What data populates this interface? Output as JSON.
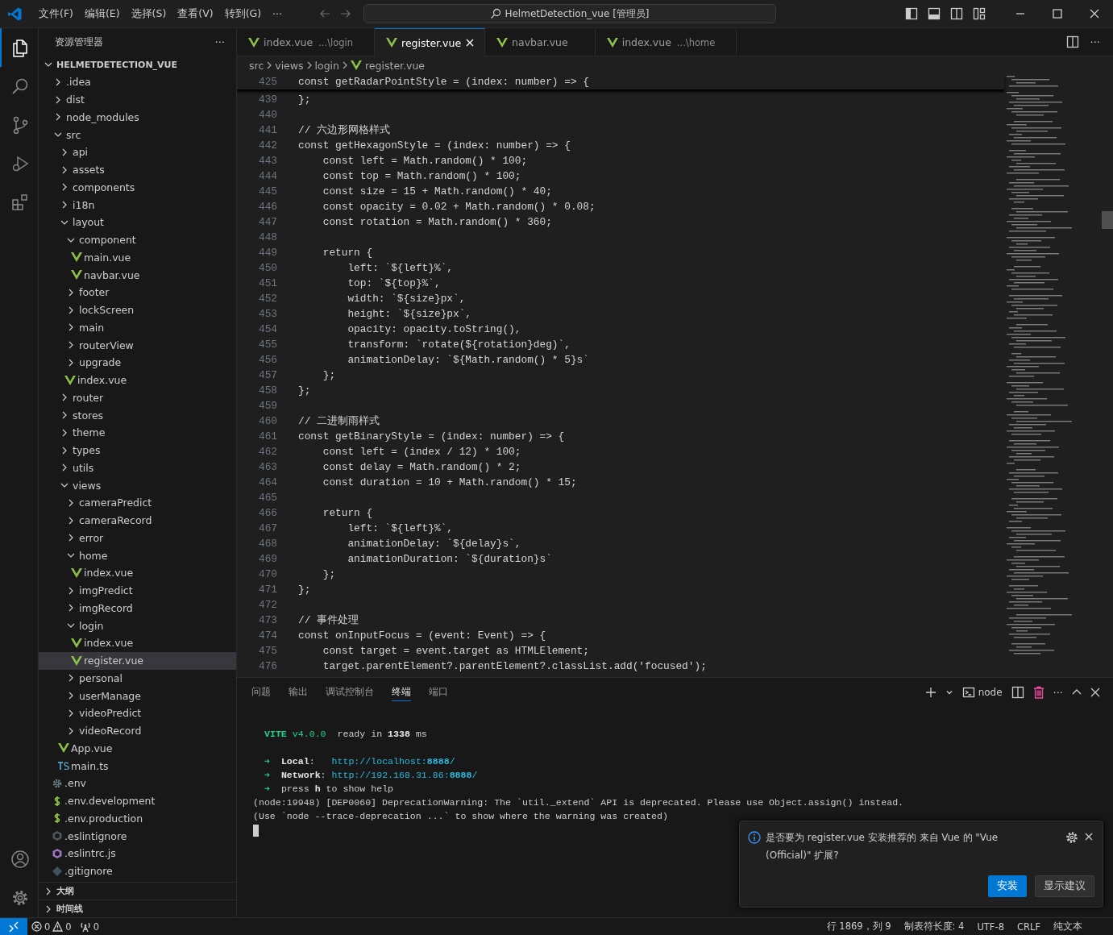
{
  "title_bar": {
    "menus": [
      "文件(F)",
      "编辑(E)",
      "选择(S)",
      "查看(V)",
      "转到(G)"
    ],
    "more": "···",
    "command_center": "HelmetDetection_vue [管理员]"
  },
  "activity_bar": {
    "items": [
      {
        "kind": "explorer",
        "selected": true
      },
      {
        "kind": "search",
        "selected": false
      },
      {
        "kind": "scm",
        "selected": false
      },
      {
        "kind": "debug",
        "selected": false
      },
      {
        "kind": "extensions",
        "selected": false
      }
    ],
    "bottom": [
      {
        "kind": "account"
      },
      {
        "kind": "settings"
      }
    ]
  },
  "sidebar": {
    "title": "资源管理器",
    "more": "···",
    "root": {
      "label": "HELMETDETECTION_VUE",
      "expanded": true
    },
    "tree": [
      {
        "label": ".idea",
        "kind": "folder",
        "expanded": false,
        "selected": false
      },
      {
        "label": "dist",
        "kind": "folder",
        "expanded": false,
        "selected": false
      },
      {
        "label": "node_modules",
        "kind": "folder",
        "expanded": false,
        "selected": false
      },
      {
        "label": "src",
        "kind": "folder",
        "expanded": true,
        "selected": false,
        "children": [
          {
            "label": "api",
            "kind": "folder",
            "expanded": false,
            "selected": false
          },
          {
            "label": "assets",
            "kind": "folder",
            "expanded": false,
            "selected": false
          },
          {
            "label": "components",
            "kind": "folder",
            "expanded": false,
            "selected": false
          },
          {
            "label": "i18n",
            "kind": "folder",
            "expanded": false,
            "selected": false
          },
          {
            "label": "layout",
            "kind": "folder",
            "expanded": true,
            "selected": false,
            "children": [
              {
                "label": "component",
                "kind": "folder",
                "expanded": true,
                "selected": false,
                "children": [
                  {
                    "label": "main.vue",
                    "kind": "vue",
                    "selected": false
                  },
                  {
                    "label": "navbar.vue",
                    "kind": "vue",
                    "selected": false
                  }
                ]
              },
              {
                "label": "footer",
                "kind": "folder",
                "expanded": false,
                "selected": false
              },
              {
                "label": "lockScreen",
                "kind": "folder",
                "expanded": false,
                "selected": false
              },
              {
                "label": "main",
                "kind": "folder",
                "expanded": false,
                "selected": false
              },
              {
                "label": "routerView",
                "kind": "folder",
                "expanded": false,
                "selected": false
              },
              {
                "label": "upgrade",
                "kind": "folder",
                "expanded": false,
                "selected": false
              },
              {
                "label": "index.vue",
                "kind": "vue",
                "selected": false
              }
            ]
          },
          {
            "label": "router",
            "kind": "folder",
            "expanded": false,
            "selected": false
          },
          {
            "label": "stores",
            "kind": "folder",
            "expanded": false,
            "selected": false
          },
          {
            "label": "theme",
            "kind": "folder",
            "expanded": false,
            "selected": false
          },
          {
            "label": "types",
            "kind": "folder",
            "expanded": false,
            "selected": false
          },
          {
            "label": "utils",
            "kind": "folder",
            "expanded": false,
            "selected": false
          },
          {
            "label": "views",
            "kind": "folder",
            "expanded": true,
            "selected": false,
            "children": [
              {
                "label": "cameraPredict",
                "kind": "folder",
                "expanded": false,
                "selected": false
              },
              {
                "label": "cameraRecord",
                "kind": "folder",
                "expanded": false,
                "selected": false
              },
              {
                "label": "error",
                "kind": "folder",
                "expanded": false,
                "selected": false
              },
              {
                "label": "home",
                "kind": "folder",
                "expanded": true,
                "selected": false,
                "children": [
                  {
                    "label": "index.vue",
                    "kind": "vue",
                    "selected": false
                  }
                ]
              },
              {
                "label": "imgPredict",
                "kind": "folder",
                "expanded": false,
                "selected": false
              },
              {
                "label": "imgRecord",
                "kind": "folder",
                "expanded": false,
                "selected": false
              },
              {
                "label": "login",
                "kind": "folder",
                "expanded": true,
                "selected": false,
                "children": [
                  {
                    "label": "index.vue",
                    "kind": "vue",
                    "selected": false
                  },
                  {
                    "label": "register.vue",
                    "kind": "vue",
                    "selected": true
                  }
                ]
              },
              {
                "label": "personal",
                "kind": "folder",
                "expanded": false,
                "selected": false
              },
              {
                "label": "userManage",
                "kind": "folder",
                "expanded": false,
                "selected": false
              },
              {
                "label": "videoPredict",
                "kind": "folder",
                "expanded": false,
                "selected": false
              },
              {
                "label": "videoRecord",
                "kind": "folder",
                "expanded": false,
                "selected": false
              }
            ]
          },
          {
            "label": "App.vue",
            "kind": "vue",
            "selected": false
          },
          {
            "label": "main.ts",
            "kind": "ts",
            "selected": false
          }
        ]
      },
      {
        "label": ".env",
        "kind": "gear",
        "selected": false
      },
      {
        "label": ".env.development",
        "kind": "dollar",
        "selected": false
      },
      {
        "label": ".env.production",
        "kind": "dollar",
        "selected": false
      },
      {
        "label": ".eslintignore",
        "kind": "ring",
        "selected": false
      },
      {
        "label": ".eslintrc.js",
        "kind": "eslint",
        "selected": false
      },
      {
        "label": ".gitignore",
        "kind": "git",
        "selected": false
      }
    ],
    "sections": [
      {
        "label": "大纲",
        "expanded": false
      },
      {
        "label": "时间线",
        "expanded": false
      }
    ]
  },
  "editor": {
    "tabs": [
      {
        "label": "index.vue",
        "description": "...\\login",
        "selected": false
      },
      {
        "label": "register.vue",
        "selected": true
      },
      {
        "label": "navbar.vue",
        "selected": false
      },
      {
        "label": "index.vue",
        "description": "...\\home",
        "selected": false
      }
    ],
    "breadcrumb": [
      "src",
      "views",
      "login",
      "register.vue"
    ],
    "sticky_line": {
      "number": "425",
      "text": "const getRadarPointStyle = (index: number) => {"
    },
    "lines": [
      {
        "number": "439",
        "text": "};"
      },
      {
        "number": "440"
      },
      {
        "number": "441",
        "text": "// 六边形网格样式"
      },
      {
        "number": "442",
        "text": "const getHexagonStyle = (index: number) => {"
      },
      {
        "number": "443",
        "text": "    const left = Math.random() * 100;"
      },
      {
        "number": "444",
        "text": "    const top = Math.random() * 100;"
      },
      {
        "number": "445",
        "text": "    const size = 15 + Math.random() * 40;"
      },
      {
        "number": "446",
        "text": "    const opacity = 0.02 + Math.random() * 0.08;"
      },
      {
        "number": "447",
        "text": "    const rotation = Math.random() * 360;"
      },
      {
        "number": "448"
      },
      {
        "number": "449",
        "text": "    return {"
      },
      {
        "number": "450",
        "text": "        left: `${left}%`,"
      },
      {
        "number": "451",
        "text": "        top: `${top}%`,"
      },
      {
        "number": "452",
        "text": "        width: `${size}px`,"
      },
      {
        "number": "453",
        "text": "        height: `${size}px`,"
      },
      {
        "number": "454",
        "text": "        opacity: opacity.toString(),"
      },
      {
        "number": "455",
        "text": "        transform: `rotate(${rotation}deg)`,"
      },
      {
        "number": "456",
        "text": "        animationDelay: `${Math.random() * 5}s`"
      },
      {
        "number": "457",
        "text": "    };"
      },
      {
        "number": "458",
        "text": "};"
      },
      {
        "number": "459"
      },
      {
        "number": "460",
        "text": "// 二进制雨样式"
      },
      {
        "number": "461",
        "text": "const getBinaryStyle = (index: number) => {"
      },
      {
        "number": "462",
        "text": "    const left = (index / 12) * 100;"
      },
      {
        "number": "463",
        "text": "    const delay = Math.random() * 2;"
      },
      {
        "number": "464",
        "text": "    const duration = 10 + Math.random() * 15;"
      },
      {
        "number": "465"
      },
      {
        "number": "466",
        "text": "    return {"
      },
      {
        "number": "467",
        "text": "        left: `${left}%`,"
      },
      {
        "number": "468",
        "text": "        animationDelay: `${delay}s`,"
      },
      {
        "number": "469",
        "text": "        animationDuration: `${duration}s`"
      },
      {
        "number": "470",
        "text": "    };"
      },
      {
        "number": "471",
        "text": "};"
      },
      {
        "number": "472"
      },
      {
        "number": "473",
        "text": "// 事件处理"
      },
      {
        "number": "474",
        "text": "const onInputFocus = (event: Event) => {"
      },
      {
        "number": "475",
        "text": "    const target = event.target as HTMLElement;"
      },
      {
        "number": "476",
        "text": "    target.parentElement?.parentElement?.classList.add('focused');"
      }
    ]
  },
  "panel": {
    "tabs": [
      {
        "label": "问题",
        "selected": false
      },
      {
        "label": "输出",
        "selected": false
      },
      {
        "label": "调试控制台",
        "selected": false
      },
      {
        "label": "终端",
        "selected": true
      },
      {
        "label": "端口",
        "selected": false
      }
    ],
    "terminal_name": "node",
    "more": "···",
    "lines": [
      {
        "indent": true,
        "gap_before": true,
        "segments": [
          {
            "text": "VITE",
            "kind": "vite"
          },
          {
            "text": " v4.0.0",
            "kind": "green"
          },
          {
            "text": "  ready in ",
            "kind": "plain"
          },
          {
            "text": "1338",
            "kind": "bold"
          },
          {
            "text": " ms",
            "kind": "plain"
          }
        ]
      },
      {
        "indent": true,
        "gap_before": true,
        "segments": [
          {
            "text": "➜",
            "kind": "arrow"
          },
          {
            "text": "Local",
            "kind": "bold"
          },
          {
            "text": ":   ",
            "kind": "plain"
          },
          {
            "text": "http://localhost:",
            "kind": "link"
          },
          {
            "text": "8888",
            "kind": "linkbold"
          },
          {
            "text": "/",
            "kind": "link"
          }
        ]
      },
      {
        "indent": true,
        "segments": [
          {
            "text": "➜",
            "kind": "arrow"
          },
          {
            "text": "Network",
            "kind": "bold"
          },
          {
            "text": ": ",
            "kind": "plain"
          },
          {
            "text": "http://192.168.31.86:",
            "kind": "link"
          },
          {
            "text": "8888",
            "kind": "linkbold"
          },
          {
            "text": "/",
            "kind": "link"
          }
        ]
      },
      {
        "indent": true,
        "segments": [
          {
            "text": "➜",
            "kind": "arrow"
          },
          {
            "text": "press ",
            "kind": "plain"
          },
          {
            "text": "h",
            "kind": "bold"
          },
          {
            "text": " to show help",
            "kind": "plain"
          }
        ]
      },
      {
        "indent": false,
        "segments": [
          {
            "text": "(node:19948) [DEP0060] DeprecationWarning: The `util._extend` API is deprecated. Please use Object.assign() instead.",
            "kind": "plain"
          }
        ]
      },
      {
        "indent": false,
        "segments": [
          {
            "text": "(Use `node --trace-deprecation ...` to show where the warning was created)",
            "kind": "plain"
          }
        ]
      }
    ]
  },
  "notification": {
    "message": "是否要为 register.vue 安装推荐的 来自 Vue 的 \"Vue (Official)\" 扩展?",
    "buttons": [
      {
        "label": "安装",
        "kind": "primary"
      },
      {
        "label": "显示建议",
        "kind": "secondary"
      }
    ]
  },
  "status_bar": {
    "errors": "0",
    "warnings": "0",
    "ports": "0",
    "items": [
      "行 1869，列 9",
      "制表符长度: 4",
      "UTF-8",
      "CRLF",
      "纯文本"
    ]
  }
}
